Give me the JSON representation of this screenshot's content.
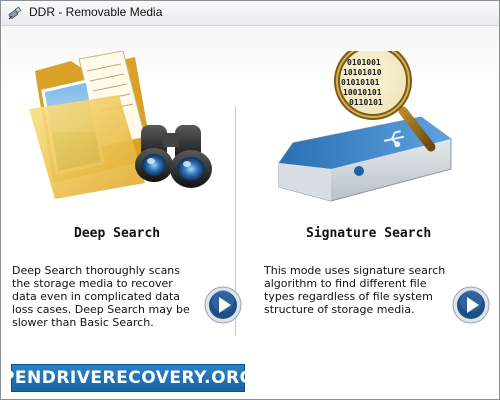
{
  "window": {
    "title": "DDR - Removable Media",
    "icon": "usb-plug-icon"
  },
  "deep_search": {
    "title": "Deep Search",
    "description": "Deep Search thoroughly scans the storage media to recover data even in complicated data loss cases. Deep Search may be slower than Basic Search.",
    "illustration": "folder-with-binoculars-icon",
    "action_icon": "play-icon"
  },
  "signature_search": {
    "title": "Signature Search",
    "description": "This mode uses signature search algorithm to find different file types regardless of file system structure of storage media.",
    "illustration": "usb-drive-with-magnifier-icon",
    "action_icon": "play-icon",
    "binary_lines": [
      "0101001",
      "10101010",
      "01010101",
      "10010101",
      "0110101"
    ]
  },
  "branding": {
    "text": "PENDRIVERECOVERY.ORG"
  },
  "colors": {
    "accent_blue": "#1f74b8",
    "play_button": "#1d4f86"
  }
}
